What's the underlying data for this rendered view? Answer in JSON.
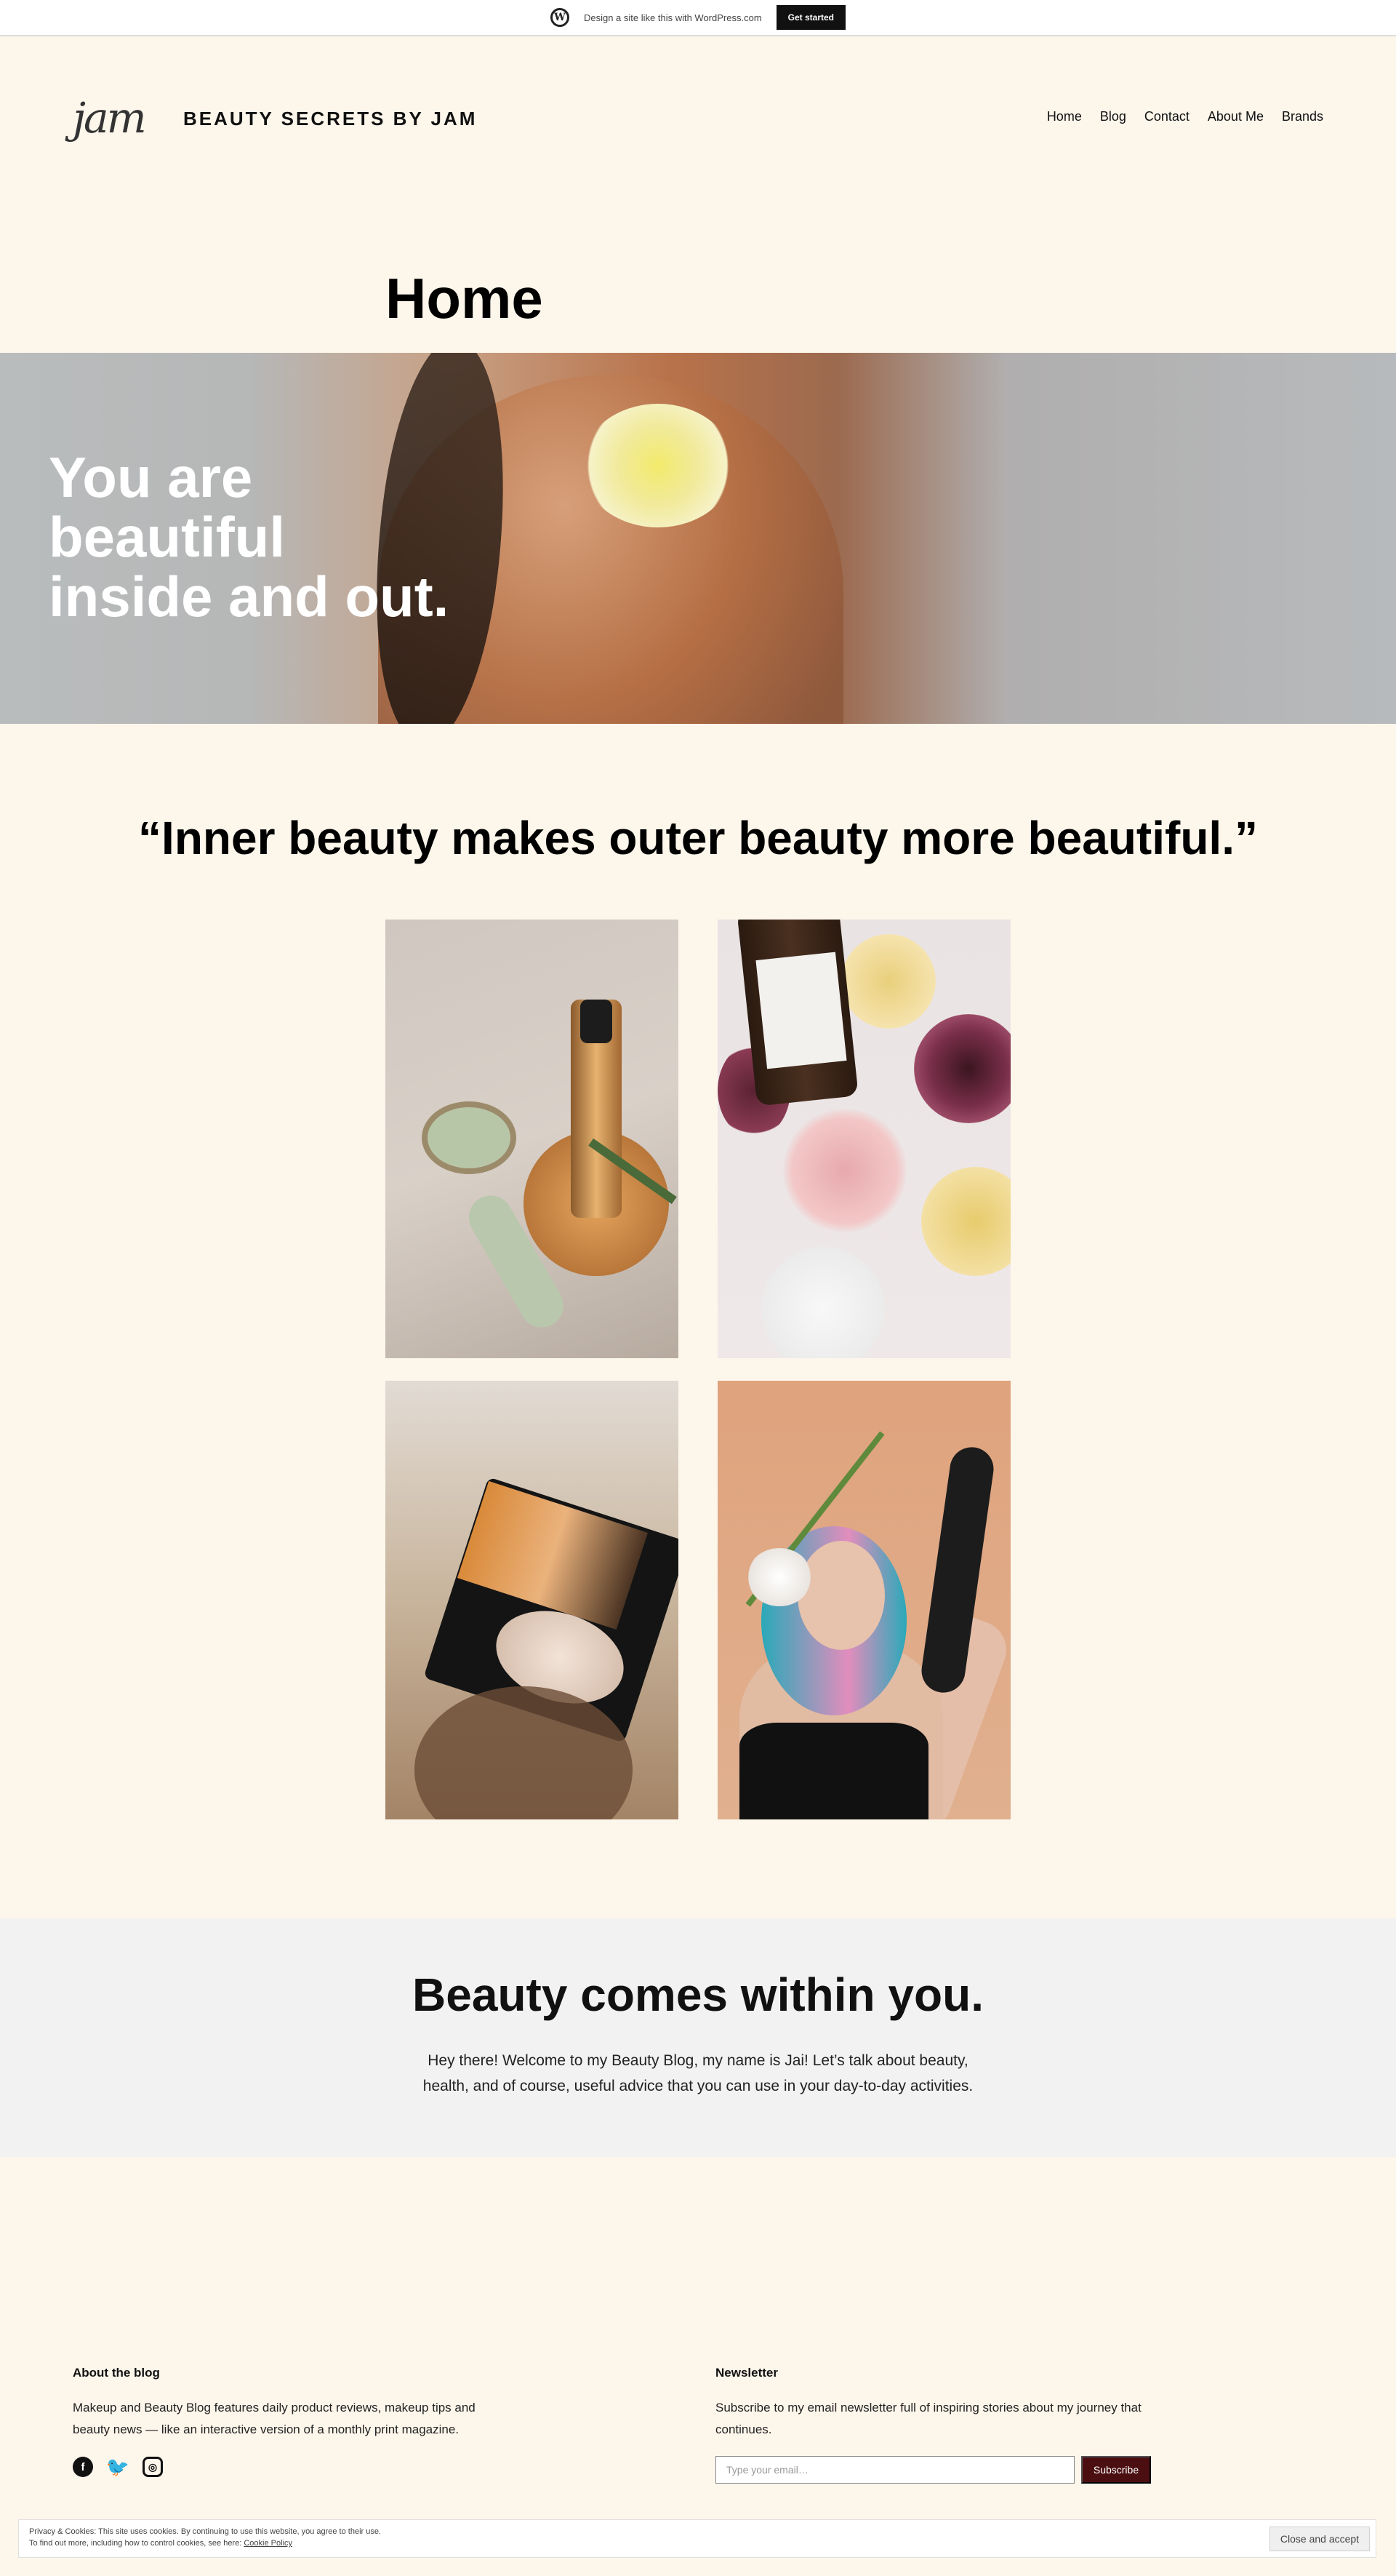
{
  "wpbar": {
    "logo_glyph": "W",
    "text": "Design a site like this with WordPress.com",
    "button": "Get started"
  },
  "header": {
    "logo": "jam",
    "site_title": "BEAUTY SECRETS BY JAM",
    "nav": [
      "Home",
      "Blog",
      "Contact",
      "About Me",
      "Brands"
    ]
  },
  "page_title": "Home",
  "hero": {
    "lines": [
      "You are",
      "beautiful",
      "inside and out."
    ]
  },
  "quote": "“Inner beauty makes outer beauty more beautiful.”",
  "intro": {
    "title": "Beauty comes within you.",
    "text": "Hey there! Welcome to my Beauty Blog, my name is Jai! Let’s talk about beauty, health, and of course, useful advice that you can use in your day-to-day activities."
  },
  "footer": {
    "about_title": "About the blog",
    "about_text": "Makeup and Beauty Blog features daily product reviews, makeup tips and beauty news — like an interactive version of a monthly print magazine.",
    "social_icons": [
      "facebook-icon",
      "twitter-icon",
      "instagram-icon"
    ],
    "newsletter_title": "Newsletter",
    "newsletter_text": "Subscribe to my email newsletter full of inspiring stories about my journey that continues.",
    "email_placeholder": "Type your email…",
    "subscribe": "Subscribe"
  },
  "cookie": {
    "line1": "Privacy & Cookies: This site uses cookies. By continuing to use this website, you agree to their use.",
    "line2_prefix": "To find out more, including how to control cookies, see here: ",
    "link": "Cookie Policy",
    "button": "Close and accept"
  },
  "colors": {
    "background": "#fdf6eb",
    "band": "#f2f2f2",
    "subscribe": "#4b0f12"
  }
}
